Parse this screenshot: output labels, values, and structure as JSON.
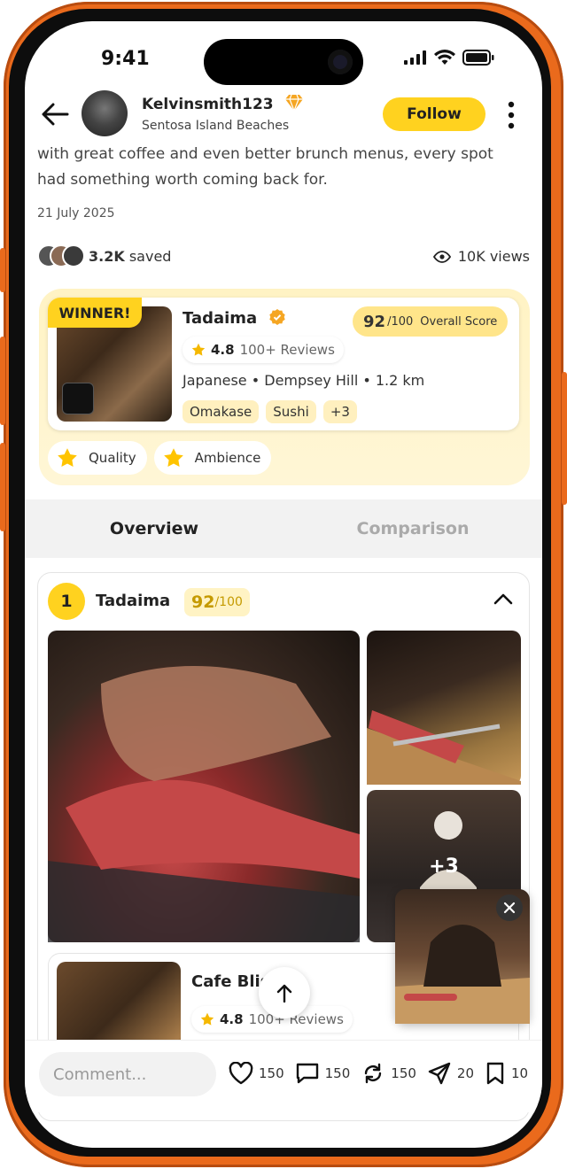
{
  "status_bar": {
    "time": "9:41"
  },
  "header": {
    "username": "Kelvinsmith123",
    "location": "Sentosa Island Beaches",
    "follow_label": "Follow"
  },
  "post": {
    "body": "with great coffee and even better brunch menus, every spot had something worth coming back for.",
    "date": "21 July 2025",
    "saved_count": "3.2K",
    "saved_label": "saved",
    "views": "10K views"
  },
  "winner": {
    "badge": "WINNER!",
    "name": "Tadaima",
    "score": "92",
    "score_suffix": "/100",
    "score_label": "Overall Score",
    "rating": "4.8",
    "reviews": "100+ Reviews",
    "meta": "Japanese • Dempsey Hill • 1.2 km",
    "tags": [
      "Omakase",
      "Sushi",
      "+3"
    ],
    "highlights": [
      "Quality",
      "Ambience"
    ]
  },
  "tabs": [
    {
      "label": "Overview",
      "active": true
    },
    {
      "label": "Comparison",
      "active": false
    }
  ],
  "ranking": {
    "rank": "1",
    "name": "Tadaima",
    "score": "92",
    "score_suffix": "/100",
    "more_photos": "+3"
  },
  "second": {
    "name": "Cafe Bliss",
    "rating": "4.8",
    "reviews": "100+ Reviews"
  },
  "bottom": {
    "comment_placeholder": "Comment...",
    "likes": "150",
    "comments": "150",
    "reposts": "150",
    "shares": "20",
    "bookmarks": "10"
  },
  "colors": {
    "accent": "#ffd21f",
    "frame": "#ea6a1c"
  }
}
